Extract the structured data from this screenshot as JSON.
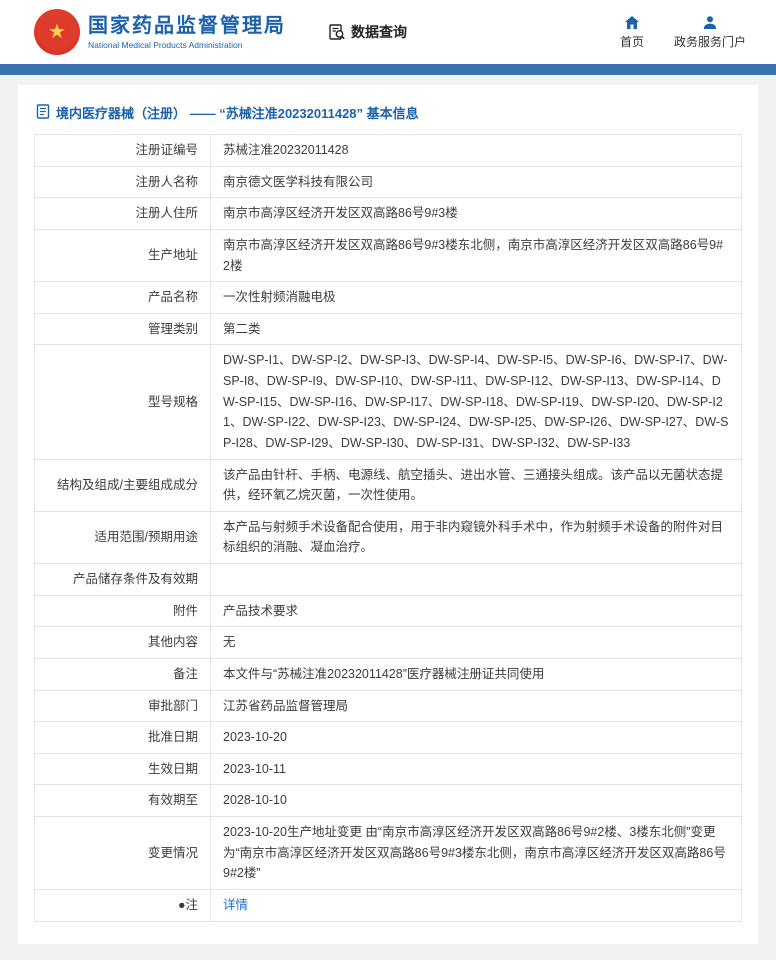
{
  "header": {
    "org_cn": "国家药品监督管理局",
    "org_en": "National Medical Products Administration",
    "data_query": "数据查询",
    "home": "首页",
    "portal": "政务服务门户"
  },
  "colors": {
    "brand_blue": "#1b62ab",
    "bar_blue": "#3a72b2",
    "emblem_red": "#d5281e",
    "link_blue": "#1a6fc4"
  },
  "icons": {
    "emblem": "national-emblem",
    "data_query": "document-search",
    "home": "house",
    "portal": "user",
    "title": "document",
    "note_bullet": "●"
  },
  "page": {
    "title": "境内医疗器械（注册） —— “苏械注准20232011428” 基本信息"
  },
  "table": {
    "rows": [
      {
        "label": "注册证编号",
        "value": "苏械注准20232011428"
      },
      {
        "label": "注册人名称",
        "value": "南京德文医学科技有限公司"
      },
      {
        "label": "注册人住所",
        "value": "南京市高淳区经济开发区双高路86号9#3楼"
      },
      {
        "label": "生产地址",
        "value": "南京市高淳区经济开发区双高路86号9#3楼东北侧，南京市高淳区经济开发区双高路86号9#2楼"
      },
      {
        "label": "产品名称",
        "value": "一次性射频消融电极"
      },
      {
        "label": "管理类别",
        "value": "第二类"
      },
      {
        "label": "型号规格",
        "value": "DW-SP-I1、DW-SP-I2、DW-SP-I3、DW-SP-I4、DW-SP-I5、DW-SP-I6、DW-SP-I7、DW-SP-I8、DW-SP-I9、DW-SP-I10、DW-SP-I11、DW-SP-I12、DW-SP-I13、DW-SP-I14、DW-SP-I15、DW-SP-I16、DW-SP-I17、DW-SP-I18、DW-SP-I19、DW-SP-I20、DW-SP-I21、DW-SP-I22、DW-SP-I23、DW-SP-I24、DW-SP-I25、DW-SP-I26、DW-SP-I27、DW-SP-I28、DW-SP-I29、DW-SP-I30、DW-SP-I31、DW-SP-I32、DW-SP-I33"
      },
      {
        "label": "结构及组成/主要组成成分",
        "value": "该产品由针杆、手柄、电源线、航空插头、进出水管、三通接头组成。该产品以无菌状态提供，经环氧乙烷灭菌，一次性使用。"
      },
      {
        "label": "适用范围/预期用途",
        "value": "本产品与射频手术设备配合使用，用于非内窥镜外科手术中，作为射频手术设备的附件对目标组织的消融、凝血治疗。"
      },
      {
        "label": "产品储存条件及有效期",
        "value": ""
      },
      {
        "label": "附件",
        "value": "产品技术要求"
      },
      {
        "label": "其他内容",
        "value": "无"
      },
      {
        "label": "备注",
        "value": "本文件与“苏械注准20232011428”医疗器械注册证共同使用"
      },
      {
        "label": "审批部门",
        "value": "江苏省药品监督管理局"
      },
      {
        "label": "批准日期",
        "value": "2023-10-20"
      },
      {
        "label": "生效日期",
        "value": "2023-10-11"
      },
      {
        "label": "有效期至",
        "value": "2028-10-10"
      },
      {
        "label": "变更情况",
        "value": "2023-10-20生产地址变更 由“南京市高淳区经济开发区双高路86号9#2楼、3楼东北侧”变更为“南京市高淳区经济开发区双高路86号9#3楼东北侧，南京市高淳区经济开发区双高路86号9#2楼”"
      },
      {
        "label": "●注",
        "value": "详情",
        "link": true
      }
    ]
  }
}
